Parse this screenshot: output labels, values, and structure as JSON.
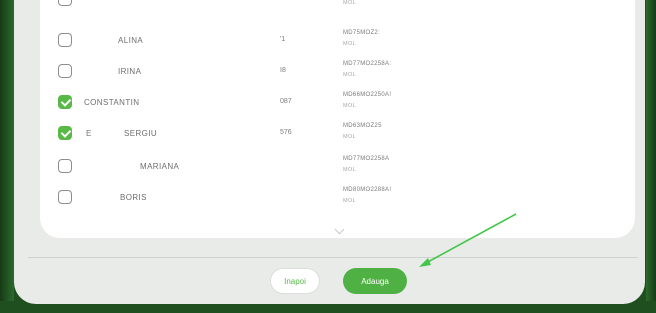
{
  "list": {
    "rows": [
      {
        "prefix": "",
        "name": "",
        "number": "",
        "code": "",
        "country": "MOL",
        "checked": false
      },
      {
        "prefix": "",
        "name": "ALINA",
        "number": "'1",
        "code": "MD75MOZ2:",
        "country": "MOL",
        "checked": false
      },
      {
        "prefix": "",
        "name": "IRINA",
        "number": "I8",
        "code": "MD77MO2258A:",
        "country": "MOL",
        "checked": false
      },
      {
        "prefix": "",
        "name": "CONSTANTIN",
        "number": "087",
        "code": "MD66MO2250A!",
        "country": "MOL",
        "checked": true
      },
      {
        "prefix": "E",
        "name": "SERGIU",
        "number": "576",
        "code": "MD63MOZ25",
        "country": "MOL",
        "checked": true
      },
      {
        "prefix": "",
        "name": "MARIANA",
        "number": "",
        "code": "MD77MO2258A",
        "country": "MOL",
        "checked": false
      },
      {
        "prefix": "",
        "name": "BORIS",
        "number": "",
        "code": "MD80MO2288A!",
        "country": "MOL",
        "checked": false
      }
    ]
  },
  "footer": {
    "back_label": "Inapoi",
    "add_label": "Adauga"
  },
  "colors": {
    "accent": "#4fb143",
    "annotation_arrow": "#43c64a"
  }
}
